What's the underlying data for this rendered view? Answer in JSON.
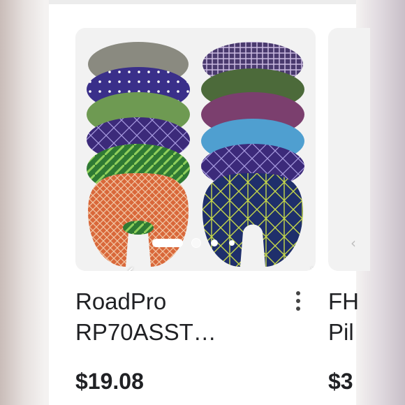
{
  "product_card": {
    "image_alt_icon": "neck-pillows-photo",
    "title": "RoadPro\nRP70ASST…",
    "price": "$19.08",
    "carousel": {
      "active_index": 1,
      "total": 4
    },
    "more_icon": "more-vert-icon",
    "prev_icon": "chevron-left-icon",
    "next_icon": "chevron-right-icon"
  },
  "next_card": {
    "title_partial": "FH\nPil",
    "price_partial": "$3"
  },
  "colors": {
    "text": "#202124",
    "image_bg": "#f2f2f2",
    "pillow_orange": "#d9683a",
    "pillow_navy": "#1f2f6b"
  }
}
